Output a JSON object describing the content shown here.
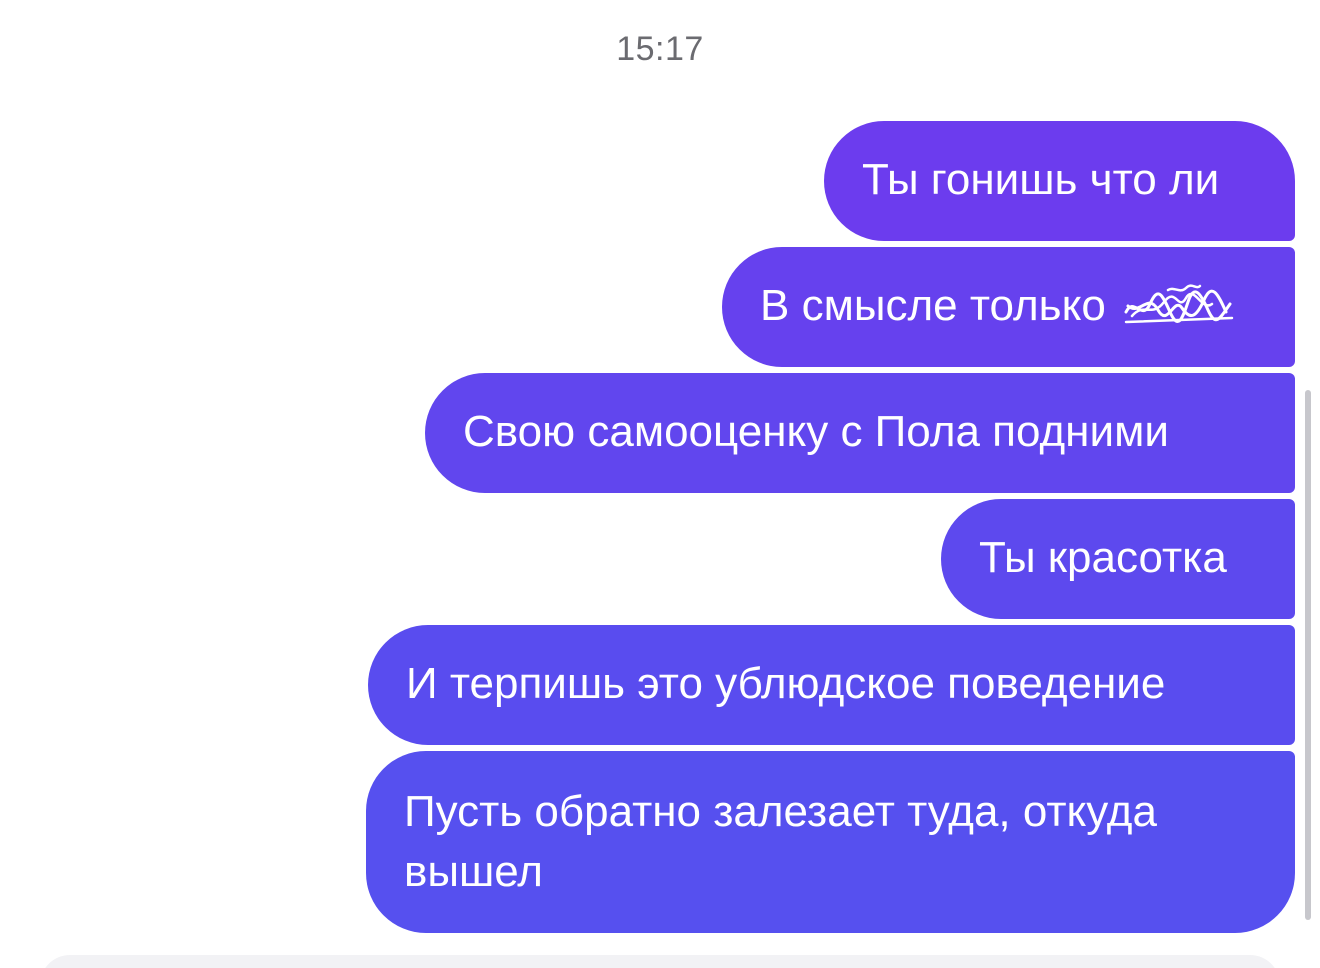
{
  "header": {
    "timestamp": "15:17"
  },
  "colors": {
    "bubble_gradient": [
      "#6c3cee",
      "#6641ee",
      "#6146ee",
      "#5d49ee",
      "#594cef",
      "#5650ef"
    ],
    "bubble_text": "#ffffff",
    "timestamp_text": "#6b6b70"
  },
  "messages": [
    {
      "text": "Ты гонишь что ли"
    },
    {
      "text": "В смысле только",
      "scribbled_suffix": "scribble-redaction"
    },
    {
      "text": "Свою самооценку с Пола подними"
    },
    {
      "text": "Ты красотка"
    },
    {
      "text": "И терпишь это ублюдское поведение"
    },
    {
      "text": "Пусть обратно залезает туда, откуда вышел"
    }
  ]
}
